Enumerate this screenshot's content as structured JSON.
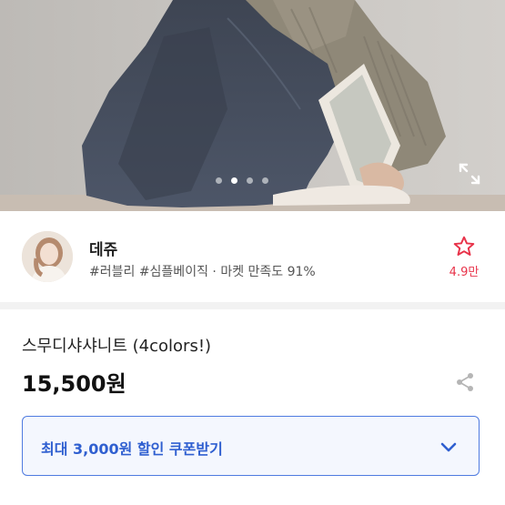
{
  "image": {
    "pagination_total": 4,
    "pagination_active": 2
  },
  "seller": {
    "name": "데쥬",
    "tags": "#러블리 #심플베이직",
    "separator": "·",
    "satisfaction": "마켓 만족도 91%",
    "favorite_count": "4.9만"
  },
  "product": {
    "name": "스무디샤샤니트 (4colors!)",
    "price": "15,500원"
  },
  "coupon": {
    "label": "최대 3,000원 할인 쿠폰받기"
  },
  "colors": {
    "accent_red": "#e8334a",
    "accent_blue": "#2f5fd0",
    "coupon_border": "#4f7be0"
  },
  "icons": [
    "expand-icon",
    "star-outline-icon",
    "share-icon",
    "chevron-down-icon"
  ]
}
